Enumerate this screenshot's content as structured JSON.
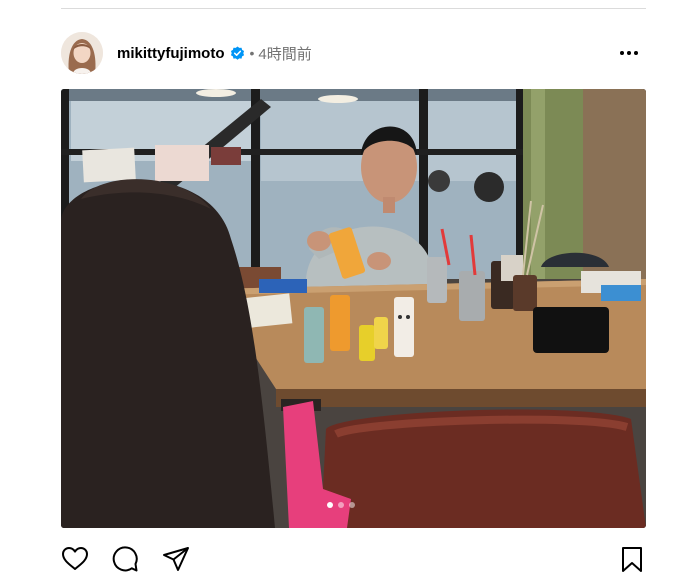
{
  "post": {
    "username": "mikittyfujimoto",
    "separator": "•",
    "timestamp": "4時間前",
    "verified": true,
    "carousel": {
      "total_slides": 3,
      "current_slide": 1
    }
  },
  "icons": {
    "more": "more-horizontal-icon",
    "verified": "verified-badge-icon",
    "next": "chevron-right-icon",
    "like": "heart-icon",
    "comment": "comment-icon",
    "share": "share-icon",
    "save": "bookmark-icon"
  },
  "colors": {
    "verified_blue": "#0095f6",
    "muted_text": "#737373",
    "divider": "#dbdbdb"
  }
}
